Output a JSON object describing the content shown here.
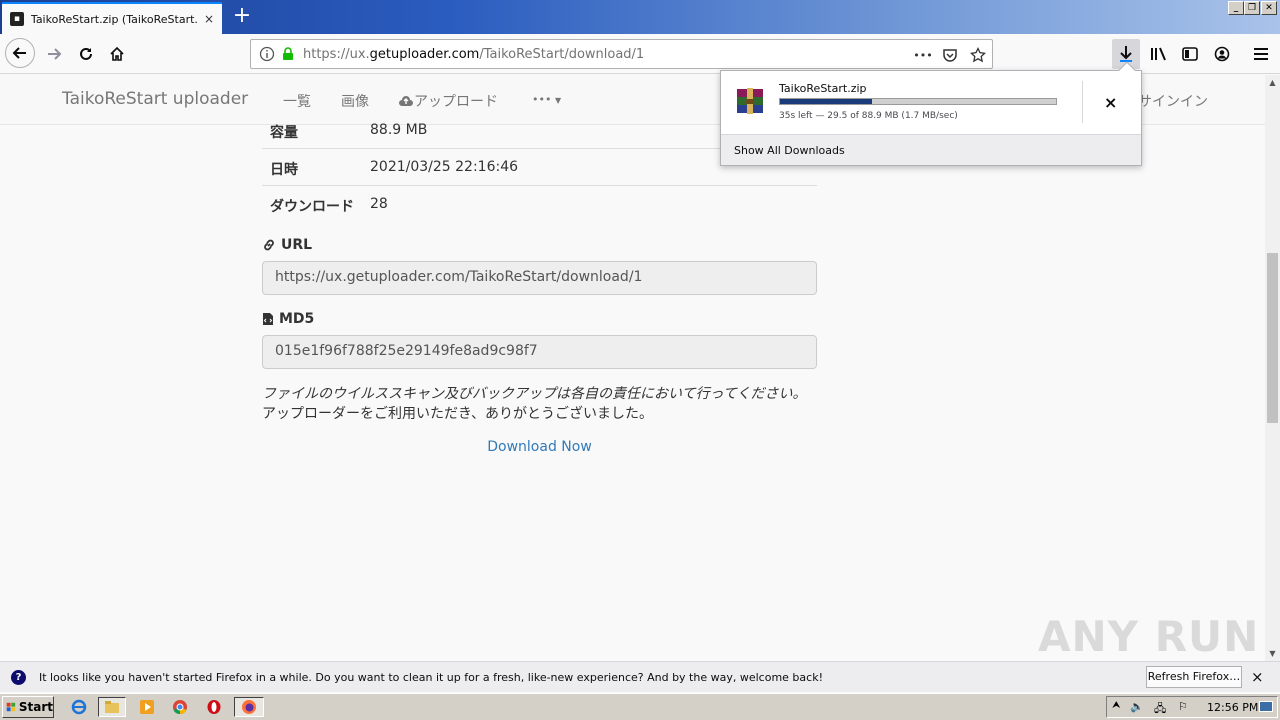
{
  "browser": {
    "tab_title": "TaikoReStart.zip (TaikoReStart.zip)",
    "tab_close": "×",
    "new_tab": "+",
    "url_prefix": "https://ux.",
    "url_domain": "getuploader.com",
    "url_path": "/TaikoReStart/download/1",
    "page_actions": "•••"
  },
  "site": {
    "brand": "TaikoReStart uploader",
    "nav": {
      "list": "一覧",
      "images": "画像",
      "upload": "アップロード",
      "more": "•••"
    },
    "signin": "サインイン"
  },
  "file_info": {
    "rows": [
      {
        "key": "容量",
        "value": "88.9 MB"
      },
      {
        "key": "日時",
        "value": "2021/03/25 22:16:46"
      },
      {
        "key": "ダウンロード",
        "value": "28"
      }
    ],
    "url_label": "URL",
    "url_value": "https://ux.getuploader.com/TaikoReStart/download/1",
    "md5_label": "MD5",
    "md5_value": "015e1f96f788f25e29149fe8ad9c98f7",
    "notice_line1": "ファイルのウイルススキャン及びバックアップは各自の責任において行ってください。",
    "notice_line2": "アップローダーをご利用いただき、ありがとうございました。",
    "download_now": "Download Now"
  },
  "download_panel": {
    "file_name": "TaikoReStart.zip",
    "progress": 0.332,
    "status": "35s left — 29.5 of 88.9 MB (1.7 MB/sec)",
    "cancel": "×",
    "show_all": "Show All Downloads"
  },
  "watermark": "ANY RUN",
  "notification": {
    "icon": "?",
    "text": "It looks like you haven't started Firefox in a while. Do you want to clean it up for a fresh, like-new experience? And by the way, welcome back!",
    "button": "Refresh Firefox…",
    "close": "×"
  },
  "taskbar": {
    "start": "Start",
    "clock": "12:56 PM"
  }
}
